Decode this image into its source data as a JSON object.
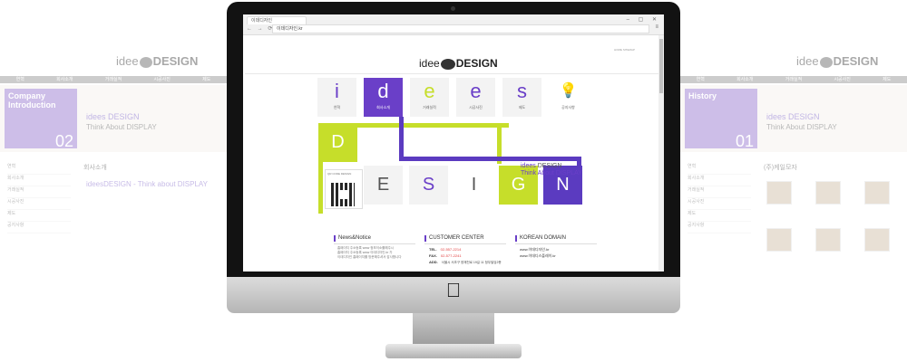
{
  "left_page": {
    "menu": [
      "연혁",
      "회사소개",
      "거래실적",
      "시공사진",
      "제도"
    ],
    "hero_title_line1": "Company",
    "hero_title_line2": "Introduction",
    "hero_number": "02",
    "hero_text1": "idees DESIGN",
    "hero_text2": "Think About DISPLAY",
    "nav": [
      "연혁",
      "회사소개",
      "거래실적",
      "시공사진",
      "제도",
      "공지사항"
    ],
    "section_title": "회사소개",
    "content_highlight": "ideesDESIGN - Think about DISPLAY"
  },
  "right_page": {
    "menu": [
      "연혁",
      "회사소개",
      "거래실적",
      "시공사진",
      "제도"
    ],
    "hero_title": "History",
    "hero_number": "01",
    "hero_text1": "idees DESIGN",
    "hero_text2": "Think About DISPLAY",
    "nav": [
      "연혁",
      "회사소개",
      "거래실적",
      "시공사진",
      "제도",
      "공지사항"
    ],
    "section_title": "(주)케일모자"
  },
  "browser": {
    "tab_title": "이데디자인",
    "address": "이데디자인.kr",
    "window_controls": "– ▢ ✕",
    "nav_buttons": "← → ⟳"
  },
  "site": {
    "top_links": "HOME  SITEMAP",
    "logo_pre": "idee",
    "logo_post": "DESIGN",
    "tiles": [
      {
        "char": "i",
        "label": "연혁"
      },
      {
        "char": "d",
        "label": "회사소개"
      },
      {
        "char": "e",
        "label": "거래실적"
      },
      {
        "char": "e",
        "label": "시공사진"
      },
      {
        "char": "s",
        "label": "제도"
      },
      {
        "char": "💡",
        "label": "공지사항"
      }
    ],
    "design_letters": [
      "D",
      "E",
      "S",
      "I",
      "G",
      "N"
    ],
    "qr_text": "QR CODE DESIGN",
    "tagline_line1_a": "idees",
    "tagline_line1_b": "DESIGN",
    "tagline_line2": "Think  About  DISPLAY",
    "news_title": "News&Notice",
    "news_lines": [
      "홈페이지 주소등록 www 정보이소를해주시",
      "홈페이지 주소등록 www 이데디자인.kr 가",
      "이데디자인 홈페이지를 방문해주셔서 감사합니다"
    ],
    "customer_title": "CUSTOMER  CENTER",
    "tel_label": "TEL.",
    "tel_value": "02-557-2214",
    "fax_label": "FAX.",
    "fax_value": "02-577-2241",
    "add_label": "ADD.",
    "add_value": "서울시 서초구 양재천로 19길 11 정우빌딩2층",
    "domain_title": "KOREAN  DOMAIN",
    "domains": [
      "www.이데디자인.kr",
      "www.이데디스플레이.kr"
    ]
  },
  "colors": {
    "purple": "#6a3fc8",
    "lime": "#c6de2a"
  }
}
